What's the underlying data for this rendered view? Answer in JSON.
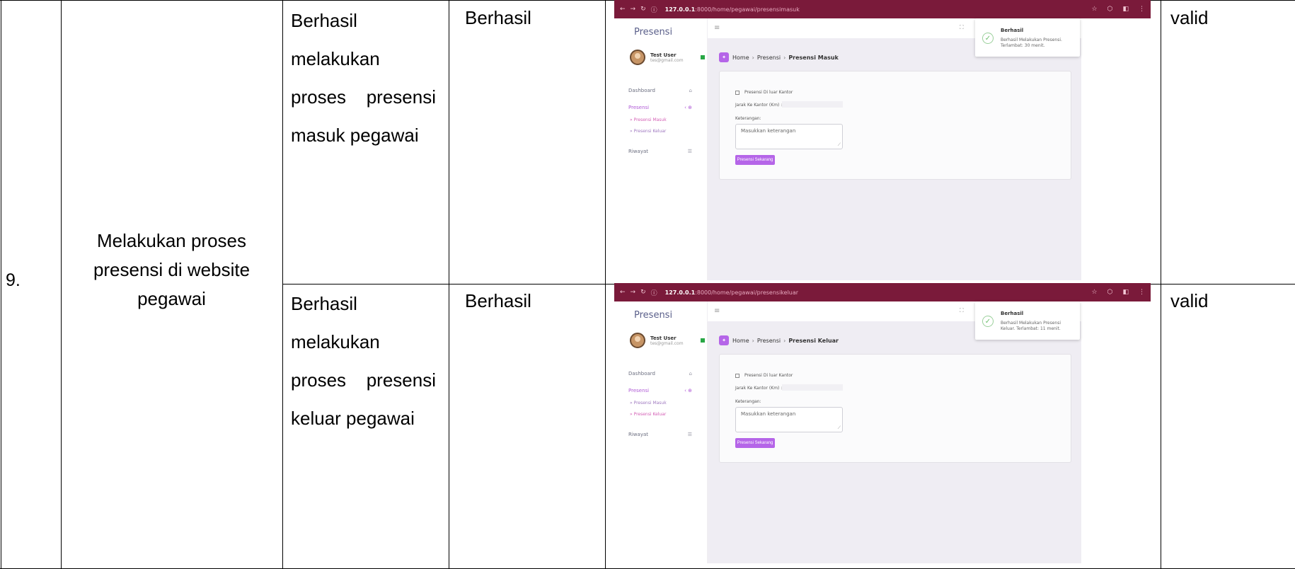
{
  "row": {
    "number": "9.",
    "scenario": "Melakukan proses presensi di website pegawai"
  },
  "cases": [
    {
      "expected_lines": [
        "Berhasil",
        "melakukan",
        "proses presensi",
        "masuk pegawai"
      ],
      "actual": "Berhasil",
      "status": "valid",
      "screenshot": {
        "url_host": "127.0.0.1",
        "url_path": ":8000/home/pegawai/presensimasuk",
        "brand": "Presensi",
        "user_name": "Test User",
        "user_email": "tes@gmail.com",
        "menu": {
          "dashboard": "Dashboard",
          "presensi": "Presensi",
          "sub_masuk": "Presensi Masuk",
          "sub_keluar": "Presensi Keluar",
          "riwayat": "Riwayat"
        },
        "active_sub": "masuk",
        "breadcrumb": [
          "Home",
          "Presensi",
          "Presensi Masuk"
        ],
        "checkbox_label": "Presensi Di luar Kantor",
        "jarak_label": "Jarak Ke Kantor (Km) :",
        "keterangan_label": "Keterangan:",
        "keterangan_placeholder": "Masukkan keterangan",
        "submit_label": "Presensi Sekarang",
        "toast_title": "Berhasil",
        "toast_message": "Berhasil Melakukan Presensi. Terlambat: 30 menit."
      }
    },
    {
      "expected_lines": [
        "Berhasil",
        "melakukan",
        "proses presensi",
        "keluar pegawai"
      ],
      "actual": "Berhasil",
      "status": "valid",
      "screenshot": {
        "url_host": "127.0.0.1",
        "url_path": ":8000/home/pegawai/presensikeluar",
        "brand": "Presensi",
        "user_name": "Test User",
        "user_email": "tes@gmail.com",
        "menu": {
          "dashboard": "Dashboard",
          "presensi": "Presensi",
          "sub_masuk": "Presensi Masuk",
          "sub_keluar": "Presensi Keluar",
          "riwayat": "Riwayat"
        },
        "active_sub": "keluar",
        "breadcrumb": [
          "Home",
          "Presensi",
          "Presensi Keluar"
        ],
        "checkbox_label": "Presensi Di luar Kantor",
        "jarak_label": "Jarak Ke Kantor (Km) :",
        "keterangan_label": "Keterangan:",
        "keterangan_placeholder": "Masukkan keterangan",
        "submit_label": "Presensi Sekarang",
        "toast_title": "Berhasil",
        "toast_message": "Berhasil Melakukan Presensi Keluar. Terlambat: 11 menit."
      }
    }
  ],
  "colors": {
    "browser_bar": "#7a1a3a",
    "accent": "#b565e8",
    "success": "#6cbf6c",
    "content_bg": "#efedf3"
  }
}
